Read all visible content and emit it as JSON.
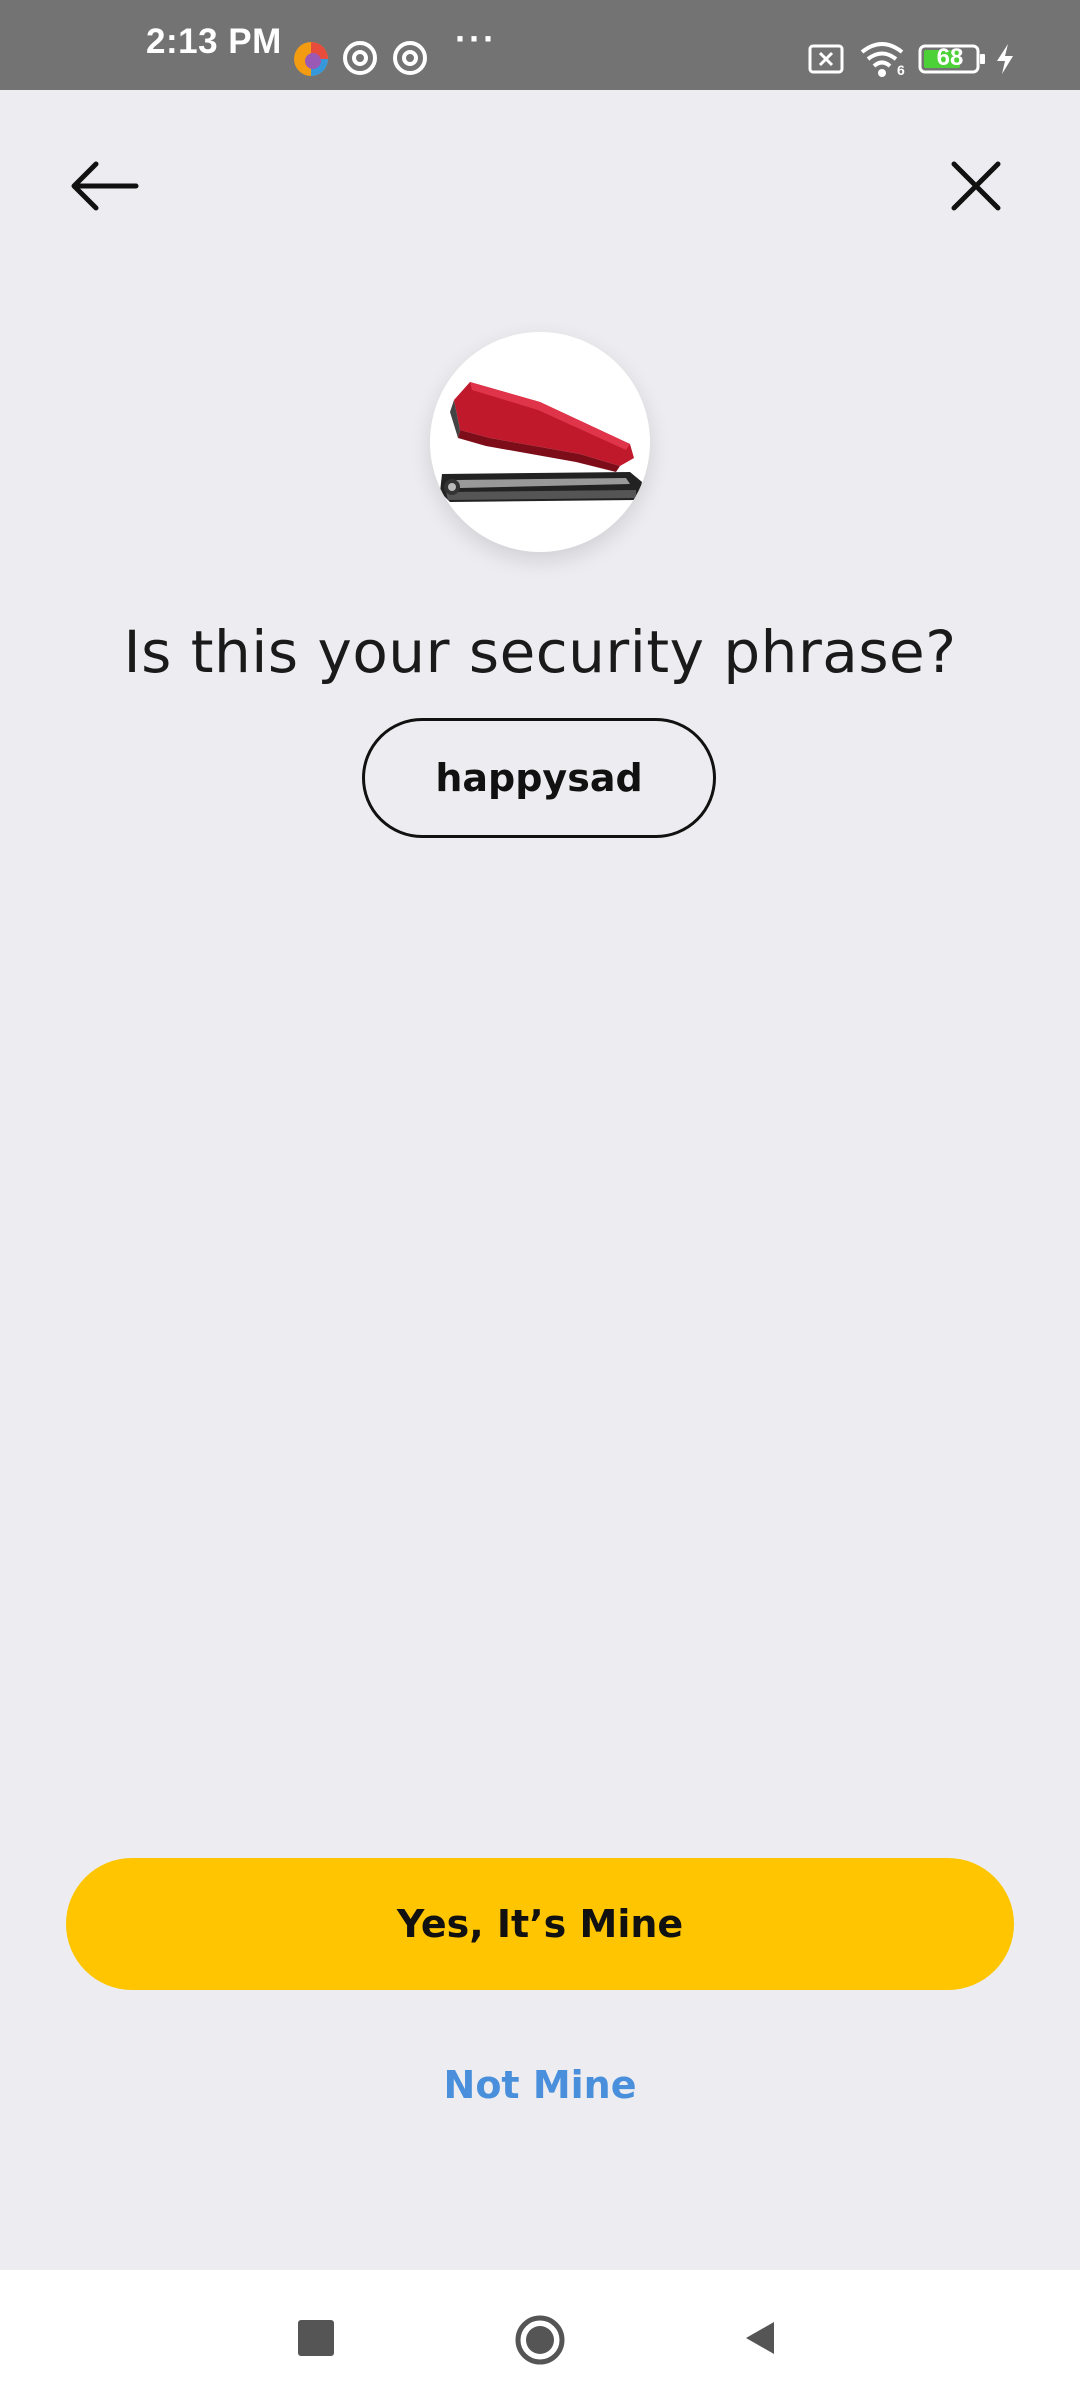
{
  "status_bar": {
    "time": "2:13 PM",
    "more": "···",
    "battery_level": "68",
    "wifi_label": "6",
    "icons": [
      "app-icon",
      "at-icon",
      "at-icon",
      "sim-off-icon",
      "wifi-icon",
      "battery-icon",
      "charging-bolt-icon"
    ]
  },
  "nav": {
    "back_icon": "arrow-left-icon",
    "close_icon": "close-icon"
  },
  "main": {
    "question": "Is this your security phrase?",
    "phrase": "happysad",
    "image": "stapler-image"
  },
  "actions": {
    "yes_label": "Yes, It’s Mine",
    "not_mine_label": "Not Mine"
  },
  "system_nav": {
    "icons": [
      "recents-square-icon",
      "home-circle-icon",
      "back-triangle-icon"
    ]
  },
  "colors": {
    "background": "#ededf1",
    "accent_yellow": "#fec500",
    "link_blue": "#4a8fdb",
    "status_bar": "#737373",
    "battery_green": "#4cd137"
  }
}
